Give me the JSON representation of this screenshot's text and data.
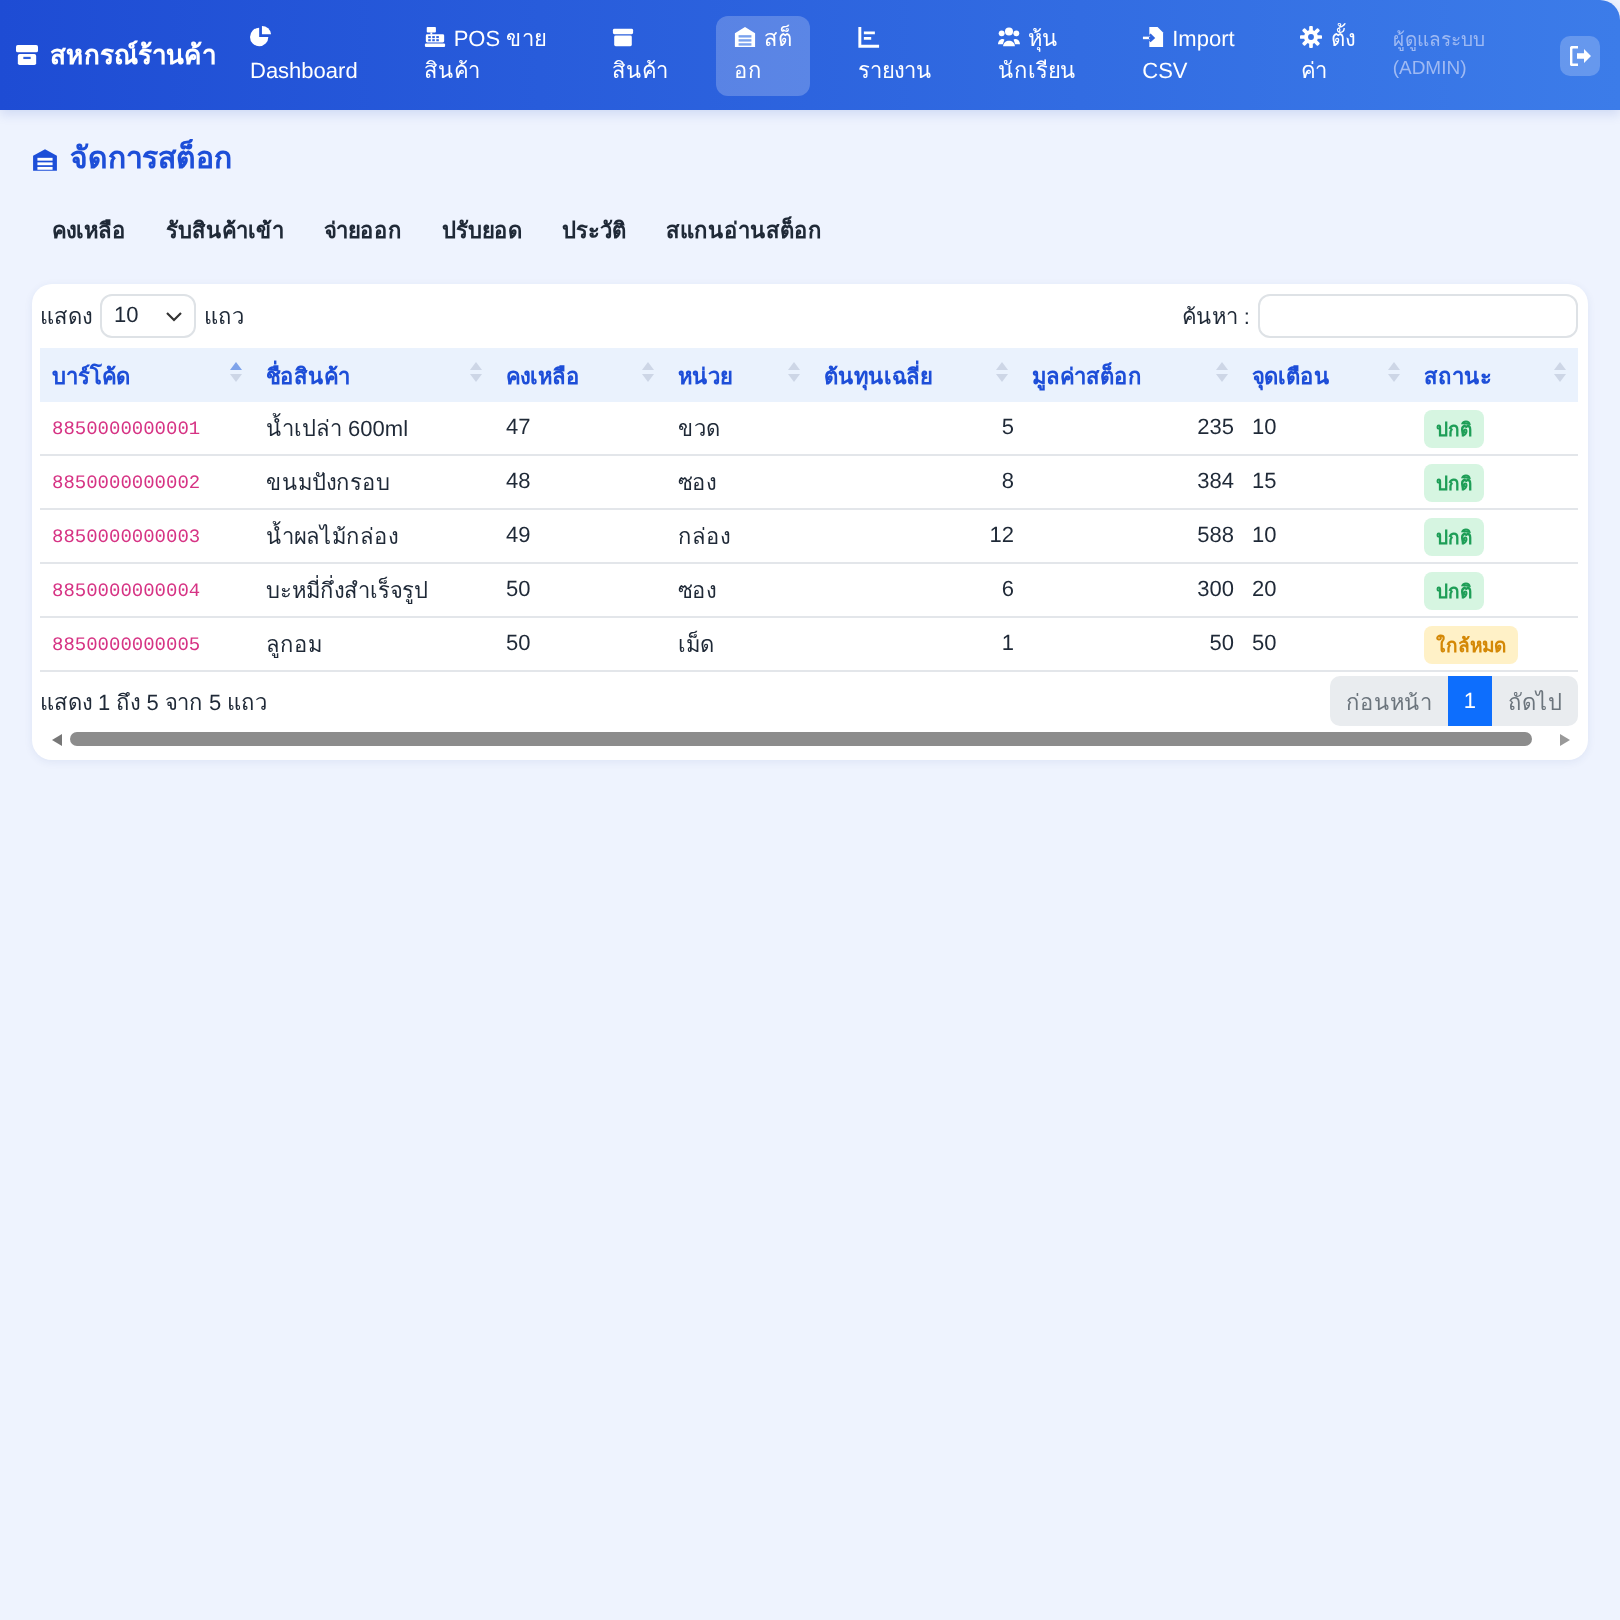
{
  "navbar": {
    "brand": "สหกรณ์ร้านค้า",
    "items": [
      {
        "label": "Dashboard",
        "selected": false
      },
      {
        "label": "POS ขาย\nสินค้า",
        "selected": false
      },
      {
        "label": "สินค้า",
        "selected": false
      },
      {
        "label": "สต็\nอก",
        "selected": true
      },
      {
        "label": "รายงาน",
        "selected": false
      },
      {
        "label": "หุ้น\nนักเรียน",
        "selected": false
      },
      {
        "label": "Import\nCSV",
        "selected": false
      },
      {
        "label": "ตั้ง\nค่า",
        "selected": false
      }
    ],
    "user": "ผู้ดูแลระบบ\n(ADMIN)"
  },
  "page": {
    "title": "จัดการสต็อก",
    "tabs": [
      {
        "label": "คงเหลือ",
        "selected": false
      },
      {
        "label": "รับสินค้าเข้า",
        "selected": false
      },
      {
        "label": "จ่ายออก",
        "selected": false
      },
      {
        "label": "ปรับยอด",
        "selected": false
      },
      {
        "label": "ประวัติ",
        "selected": false
      },
      {
        "label": "สแกนอ่านสต็อก",
        "selected": false
      }
    ]
  },
  "stock_table": {
    "length_before": "แสดง",
    "page_size": "10",
    "length_after": "แถว",
    "search_label": "ค้นหา :",
    "columns": [
      {
        "label": "บาร์โค้ด",
        "sort_ascending": true
      },
      {
        "label": "ชื่อสินค้า",
        "sort_ascending": false
      },
      {
        "label": "คงเหลือ",
        "sort_ascending": false
      },
      {
        "label": "หน่วย",
        "sort_ascending": false
      },
      {
        "label": "ต้นทุนเฉลี่ย",
        "sort_ascending": false
      },
      {
        "label": "มูลค่าสต็อก",
        "sort_ascending": false
      },
      {
        "label": "จุดเตือน",
        "sort_ascending": false
      },
      {
        "label": "สถานะ",
        "sort_ascending": false
      }
    ],
    "rows": [
      {
        "barcode": "8850000000001",
        "name": "น้ำเปล่า 600ml",
        "stock": "47",
        "unit": "ขวด",
        "avg_cost": "5",
        "value": "235",
        "alert_level": "10",
        "status": {
          "label": "ปกติ",
          "kind": "normal"
        }
      },
      {
        "barcode": "8850000000002",
        "name": "ขนมปังกรอบ",
        "stock": "48",
        "unit": "ซอง",
        "avg_cost": "8",
        "value": "384",
        "alert_level": "15",
        "status": {
          "label": "ปกติ",
          "kind": "normal"
        }
      },
      {
        "barcode": "8850000000003",
        "name": "น้ำผลไม้กล่อง",
        "stock": "49",
        "unit": "กล่อง",
        "avg_cost": "12",
        "value": "588",
        "alert_level": "10",
        "status": {
          "label": "ปกติ",
          "kind": "normal"
        }
      },
      {
        "barcode": "8850000000004",
        "name": "บะหมี่กึ่งสำเร็จรูป",
        "stock": "50",
        "unit": "ซอง",
        "avg_cost": "6",
        "value": "300",
        "alert_level": "20",
        "status": {
          "label": "ปกติ",
          "kind": "normal"
        }
      },
      {
        "barcode": "8850000000005",
        "name": "ลูกอม",
        "stock": "50",
        "unit": "เม็ด",
        "avg_cost": "1",
        "value": "50",
        "alert_level": "50",
        "status": {
          "label": "ใกล้หมด",
          "kind": "low"
        }
      }
    ],
    "info": "แสดง 1 ถึง 5 จาก 5 แถว",
    "pagination": [
      {
        "label": "ก่อนหน้า",
        "selected": false,
        "disabled": true
      },
      {
        "label": "1",
        "selected": true,
        "disabled": false
      },
      {
        "label": "ถัดไป",
        "selected": false,
        "disabled": true
      }
    ]
  }
}
